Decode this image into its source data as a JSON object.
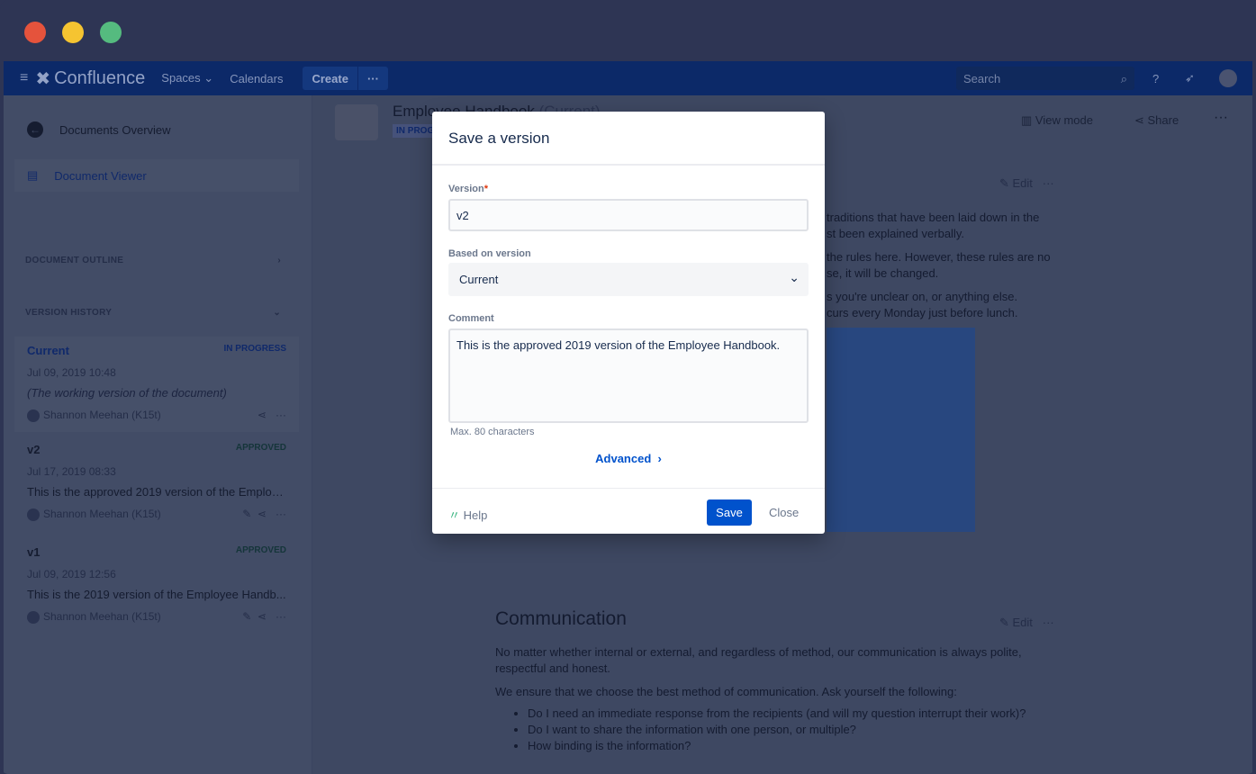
{
  "window": {
    "lights": [
      "#e5533c",
      "#f5c431",
      "#55bb7f"
    ]
  },
  "nav": {
    "brand": "Confluence",
    "spaces": "Spaces",
    "calendars": "Calendars",
    "create": "Create",
    "more": "···",
    "search_placeholder": "Search"
  },
  "sidebar": {
    "overview": "Documents Overview",
    "viewer": "Document Viewer",
    "outline": "DOCUMENT OUTLINE",
    "history": "VERSION HISTORY",
    "versions": [
      {
        "name": "Current",
        "status": "IN PROGRESS",
        "date": "Jul 09, 2019 10:48",
        "comment": "(The working version of the document)",
        "author": "Shannon Meehan (K15t)"
      },
      {
        "name": "v2",
        "status": "APPROVED",
        "date": "Jul 17, 2019 08:33",
        "comment": "This is the approved 2019 version of the Employ...",
        "author": "Shannon Meehan (K15t)"
      },
      {
        "name": "v1",
        "status": "APPROVED",
        "date": "Jul 09, 2019 12:56",
        "comment": "This is the 2019 version of the Employee Handb...",
        "author": "Shannon Meehan (K15t)"
      }
    ]
  },
  "page": {
    "title": "Employee Handbook",
    "title_suffix": "(Current)",
    "status": "IN PROGRESS",
    "view_mode": "View mode",
    "share": "Share",
    "edit": "Edit",
    "para1a": "traditions that have been laid down in the",
    "para1b": "st been explained verbally.",
    "para2a": "the rules here. However, these rules are no",
    "para2b": "se, it will be changed.",
    "para3a": "s you're unclear on, or anything else.",
    "para3b": "curs every Monday just before lunch.",
    "section": "Communication",
    "section_p1": "No matter whether internal or external, and regardless of method, our communication is always polite, respectful and honest.",
    "section_p2": "We ensure that we choose the best method of communication. Ask yourself the following:",
    "bullets": [
      "Do I need an immediate response from the recipients (and will my question interrupt their work)?",
      "Do I want to share the information with one person, or multiple?",
      "How binding is the information?"
    ]
  },
  "modal": {
    "title": "Save a version",
    "version_label": "Version",
    "required": "*",
    "version_value": "v2",
    "based_label": "Based on version",
    "based_value": "Current",
    "comment_label": "Comment",
    "comment_value": "This is the approved 2019 version of the Employee Handbook.",
    "hint": "Max. 80 characters",
    "advanced": "Advanced",
    "help": "Help",
    "save": "Save",
    "close": "Close"
  }
}
